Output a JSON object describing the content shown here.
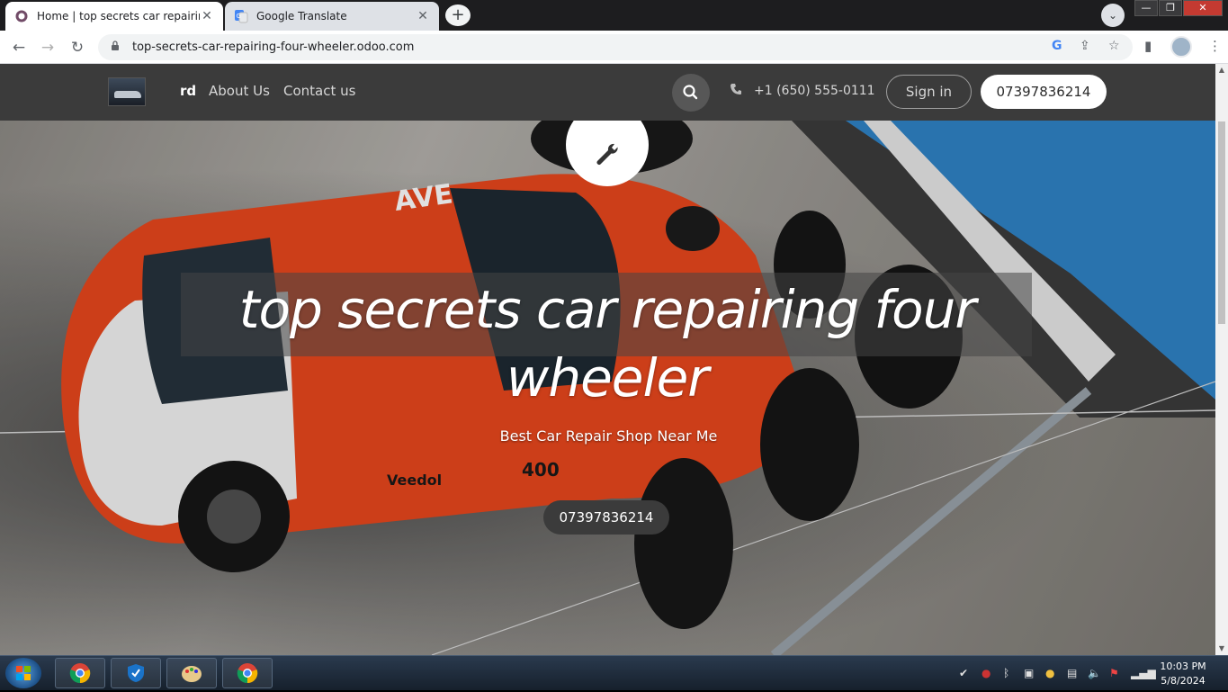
{
  "browser": {
    "tabs": [
      {
        "title": "Home | top secrets car repairing f",
        "active": true
      },
      {
        "title": "Google Translate",
        "active": false
      }
    ],
    "new_tab_label": "+",
    "close_glyph": "✕",
    "address": "top-secrets-car-repairing-four-wheeler.odoo.com",
    "window_controls": {
      "minimize": "—",
      "maximize": "❐",
      "close": "✕"
    }
  },
  "site": {
    "nav": {
      "items": [
        "rd",
        "About Us",
        "Contact us"
      ],
      "phone": "+1 (650) 555-0111",
      "signin": "Sign in",
      "cta": "07397836214"
    },
    "hero": {
      "title": "top secrets car repairing four wheeler",
      "subtitle": "Best Car Repair Shop Near Me",
      "button": "07397836214"
    }
  },
  "taskbar": {
    "time": "10:03 PM",
    "date": "5/8/2024"
  },
  "colors": {
    "header_bg": "#3b3b3b",
    "tab_strip_bg": "#1d1d1f",
    "car_orange": "#e9471d"
  },
  "icons": [
    "search-icon",
    "phone-icon",
    "wrench-icon",
    "lock-icon",
    "star-icon",
    "share-icon"
  ]
}
